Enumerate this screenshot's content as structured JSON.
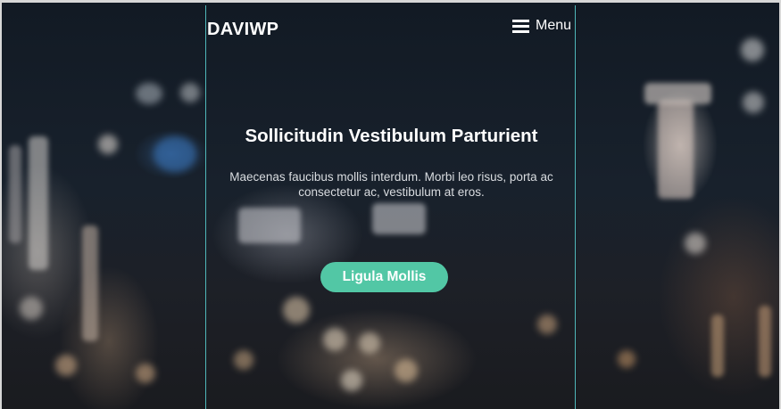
{
  "header": {
    "brand": "DAVIWP",
    "menu_label": "Menu",
    "menu_icon": "hamburger-icon"
  },
  "hero": {
    "title": "Sollicitudin Vestibulum Parturient",
    "description": "Maecenas faucibus mollis interdum. Morbi leo risus, porta ac consectetur ac, vestibulum at eros.",
    "button_label": "Ligula Mollis"
  },
  "colors": {
    "accent": "#52c7a5",
    "guide_lines": "#4fb7b9",
    "background": "#18212c"
  }
}
